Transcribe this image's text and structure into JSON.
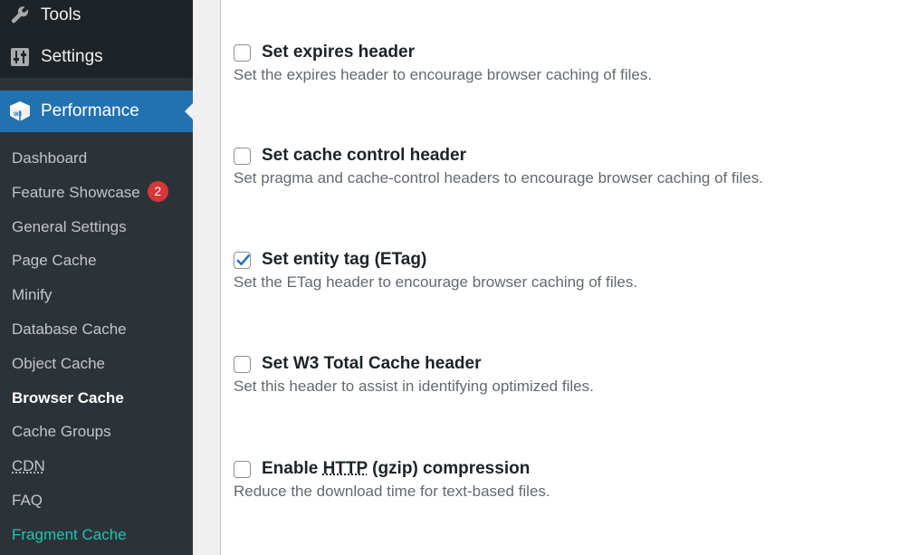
{
  "sidebar": {
    "top_items": [
      {
        "label": "Tools",
        "icon": "wrench-icon"
      },
      {
        "label": "Settings",
        "icon": "settings-sliders-icon"
      }
    ],
    "active_menu": {
      "label": "Performance",
      "icon": "w3tc-cube-icon",
      "color": "#2271b1"
    },
    "submenu": [
      {
        "label": "Dashboard"
      },
      {
        "label": "Feature Showcase",
        "badge": "2"
      },
      {
        "label": "General Settings"
      },
      {
        "label": "Page Cache"
      },
      {
        "label": "Minify"
      },
      {
        "label": "Database Cache"
      },
      {
        "label": "Object Cache"
      },
      {
        "label": "Browser Cache",
        "current": true
      },
      {
        "label": "Cache Groups"
      },
      {
        "label": "CDN"
      },
      {
        "label": "FAQ"
      },
      {
        "label": "Fragment Cache",
        "accent_color": "#1fc3b4"
      }
    ]
  },
  "options": [
    {
      "label": "Set expires header",
      "description": "Set the expires header to encourage browser caching of files.",
      "checked": false
    },
    {
      "label": "Set cache control header",
      "description": "Set pragma and cache-control headers to encourage browser caching of files.",
      "checked": false
    },
    {
      "label": "Set entity tag (ETag)",
      "description": "Set the ETag header to encourage browser caching of files.",
      "checked": true
    },
    {
      "label": "Set W3 Total Cache header",
      "description": "Set this header to assist in identifying optimized files.",
      "checked": false
    },
    {
      "label_prefix": "Enable ",
      "label_abbr": "HTTP",
      "label_suffix": " (gzip) compression",
      "description": "Reduce the download time for text-based files.",
      "checked": false
    }
  ],
  "colors": {
    "checkmark": "#2271b1",
    "badge": "#d63638"
  }
}
